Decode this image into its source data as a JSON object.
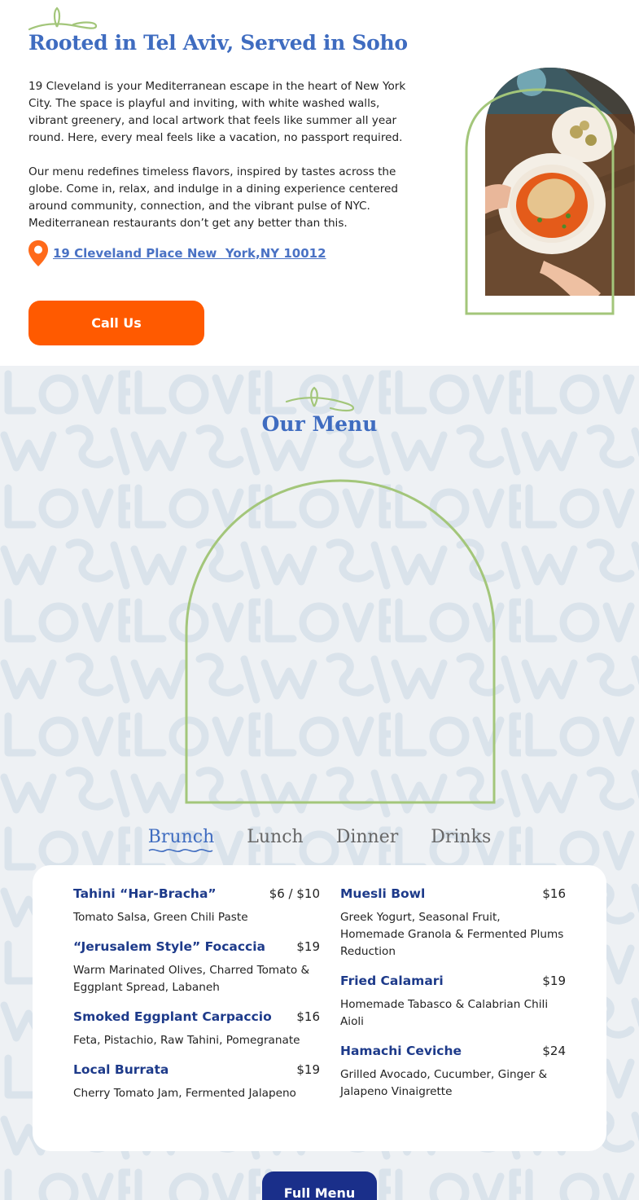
{
  "about": {
    "title": "Rooted in Tel Aviv, Served in Soho",
    "paragraph1": "19 Cleveland is your Mediterranean escape in the heart of New York City. The space is playful and inviting, with white washed walls, vibrant greenery, and local artwork that feels like summer all year round. Here, every meal feels like a vacation, no passport required.",
    "paragraph2": "Our menu redefines timeless flavors, inspired by tastes across the globe. Come in, relax, and indulge in a dining experience centered around community, connection, and the vibrant pulse of NYC. Mediterranean restaurants don’t get any better than this.",
    "address": "19 Cleveland Place New  York,NY 10012",
    "call_label": "Call Us"
  },
  "menu": {
    "title": "Our Menu",
    "tabs": [
      "Brunch",
      "Lunch",
      "Dinner",
      "Drinks"
    ],
    "active_tab": "Brunch",
    "left_items": [
      {
        "name": "Tahini “Har-Bracha”",
        "price": "$6 / $10",
        "desc": "Tomato Salsa, Green Chili Paste"
      },
      {
        "name": "“Jerusalem Style” Focaccia",
        "price": "$19",
        "desc": "Warm Marinated Olives, Charred Tomato & Eggplant Spread, Labaneh"
      },
      {
        "name": "Smoked Eggplant Carpaccio",
        "price": "$16",
        "desc": "Feta, Pistachio, Raw Tahini, Pomegranate"
      },
      {
        "name": "Local Burrata",
        "price": "$19",
        "desc": "Cherry Tomato Jam, Fermented Jalapeno"
      }
    ],
    "right_items": [
      {
        "name": "Muesli Bowl",
        "price": "$16",
        "desc": "Greek Yogurt, Seasonal Fruit, Homemade Granola & Fermented Plums Reduction"
      },
      {
        "name": "Fried Calamari",
        "price": "$19",
        "desc": "Homemade Tabasco & Calabrian Chili Aioli"
      },
      {
        "name": "Hamachi Ceviche",
        "price": "$24",
        "desc": "Grilled Avocado, Cucumber, Ginger & Jalapeno Vinaigrette"
      }
    ],
    "full_menu_label": "Full Menu"
  },
  "colors": {
    "accent_blue": "#3f6cc0",
    "navy": "#1d3a8a",
    "orange": "#ff5a00",
    "sprig_green": "#a3c67a"
  },
  "icons": [
    "sprig-icon",
    "location-pin-icon",
    "squiggle-underline-icon"
  ]
}
